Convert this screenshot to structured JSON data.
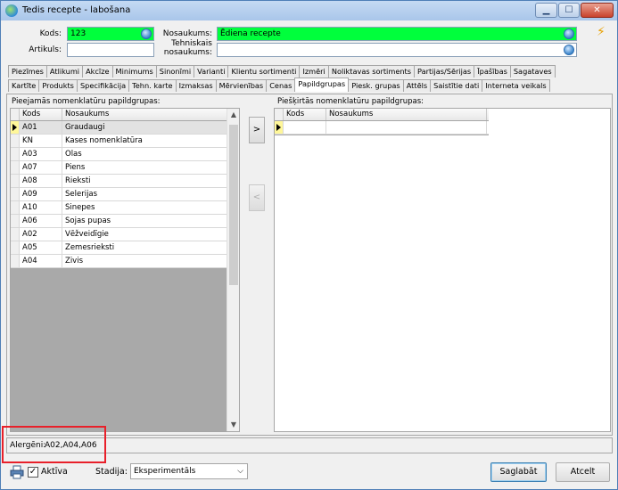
{
  "window": {
    "title": "Tedis recepte - labošana"
  },
  "header": {
    "kods_label": "Kods:",
    "kods_value": "123",
    "artikuls_label": "Artikuls:",
    "artikuls_value": "",
    "nosaukums_label": "Nosaukums:",
    "nosaukums_value": "Ēdiena recepte",
    "tehn_label_1": "Tehniskais",
    "tehn_label_2": "nosaukums:",
    "tehn_value": ""
  },
  "tabs_row1": [
    "Piezīmes",
    "Atlikumi",
    "Akcīze",
    "Minimums",
    "Sinonīmi",
    "Varianti",
    "Klientu sortimenti",
    "Izmēri",
    "Noliktavas sortiments",
    "Partijas/Sērijas",
    "Īpašības",
    "Sagataves"
  ],
  "tabs_row2": [
    "Kartīte",
    "Produkts",
    "Specifikācija",
    "Tehn. karte",
    "Izmaksas",
    "Mērvienības",
    "Cenas",
    "Papildgrupas",
    "Piesk. grupas",
    "Attēls",
    "Saistītie dati",
    "Interneta veikals"
  ],
  "active_tab": "Papildgrupas",
  "left_grid": {
    "title": "Pieejamās nomenklatūru papildgrupas:",
    "columns": [
      "Kods",
      "Nosaukums"
    ],
    "rows": [
      [
        "A01",
        "Graudaugi"
      ],
      [
        "KN",
        "Kases nomenklatūra"
      ],
      [
        "A03",
        "Olas"
      ],
      [
        "A07",
        "Piens"
      ],
      [
        "A08",
        "Rieksti"
      ],
      [
        "A09",
        "Selerijas"
      ],
      [
        "A10",
        "Sinepes"
      ],
      [
        "A06",
        "Sojas pupas"
      ],
      [
        "A02",
        "Vēžveidīgie"
      ],
      [
        "A05",
        "Zemesrieksti"
      ],
      [
        "A04",
        "Zivis"
      ]
    ]
  },
  "right_grid": {
    "title": "Piešķirtās nomenklatūru papildgrupas:",
    "columns": [
      "Kods",
      "Nosaukums"
    ]
  },
  "move_buttons": {
    "add": ">",
    "remove": "<"
  },
  "alergeni": {
    "label": "Alergēni:",
    "value": "A02,A04,A06"
  },
  "footer": {
    "aktiva_label": "Aktīva",
    "stadija_label": "Stadija:",
    "stadija_value": "Eksperimentāls",
    "save_label": "Saglabāt",
    "cancel_label": "Atcelt"
  },
  "colors": {
    "required_field": "#00ff3c",
    "highlight": "#e8202a"
  }
}
